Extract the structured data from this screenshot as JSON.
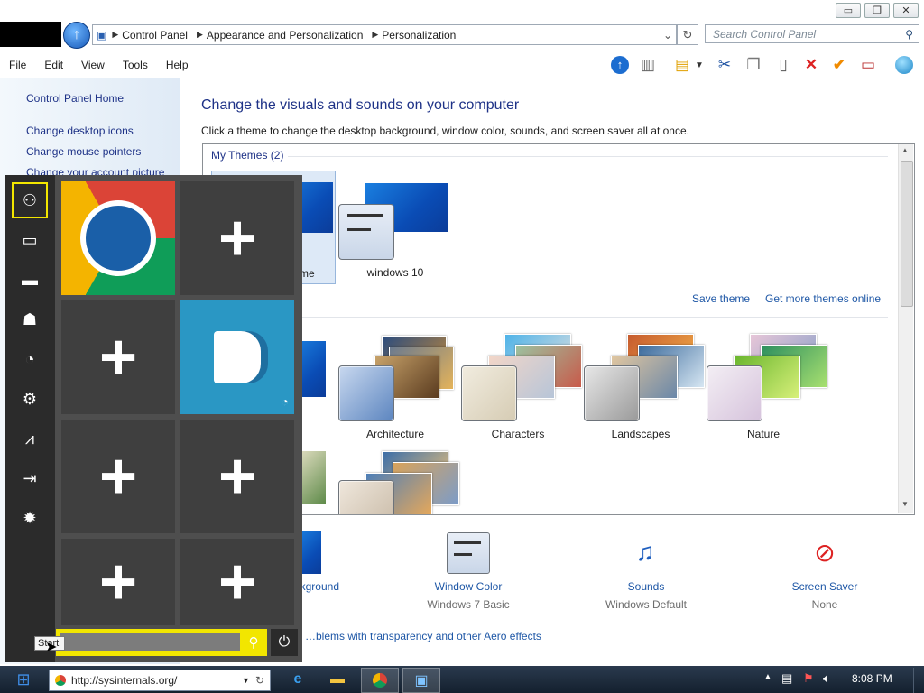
{
  "window": {
    "minimize": "▭",
    "restore": "❐",
    "close": "✕"
  },
  "address": {
    "crumbs": [
      "Control Panel",
      "Appearance and Personalization",
      "Personalization"
    ],
    "search_placeholder": "Search Control Panel"
  },
  "menu": {
    "items": [
      "File",
      "Edit",
      "View",
      "Tools",
      "Help"
    ]
  },
  "leftnav": {
    "home": "Control Panel Home",
    "links": [
      "Change desktop icons",
      "Change mouse pointers",
      "Change your account picture"
    ]
  },
  "main": {
    "heading": "Change the visuals and sounds on your computer",
    "subtitle": "Click a theme to change the desktop background, window color, sounds, and screen saver all at once.",
    "my_themes_label": "My Themes (2)",
    "my_themes": [
      "…me",
      "windows 10"
    ],
    "save_theme": "Save theme",
    "get_more": "Get more themes online",
    "aero_themes": [
      "Architecture",
      "Characters",
      "Landscapes",
      "Nature"
    ],
    "bottom": [
      {
        "label": "…kground",
        "sub": ""
      },
      {
        "label": "Window Color",
        "sub": "Windows 7 Basic"
      },
      {
        "label": "Sounds",
        "sub": "Windows Default"
      },
      {
        "label": "Screen Saver",
        "sub": "None"
      }
    ],
    "aero_link": "…blems with transparency and other Aero effects"
  },
  "startmenu": {
    "tooltip": "Start"
  },
  "taskbar": {
    "url": "http://sysinternals.org/",
    "clock": "8:08 PM"
  },
  "colors": {
    "accent_yellow": "#f2e600",
    "link_blue": "#1e57a6",
    "chrome_red": "#db4437",
    "chrome_green": "#0f9d58",
    "chrome_yellow": "#f4b400"
  }
}
